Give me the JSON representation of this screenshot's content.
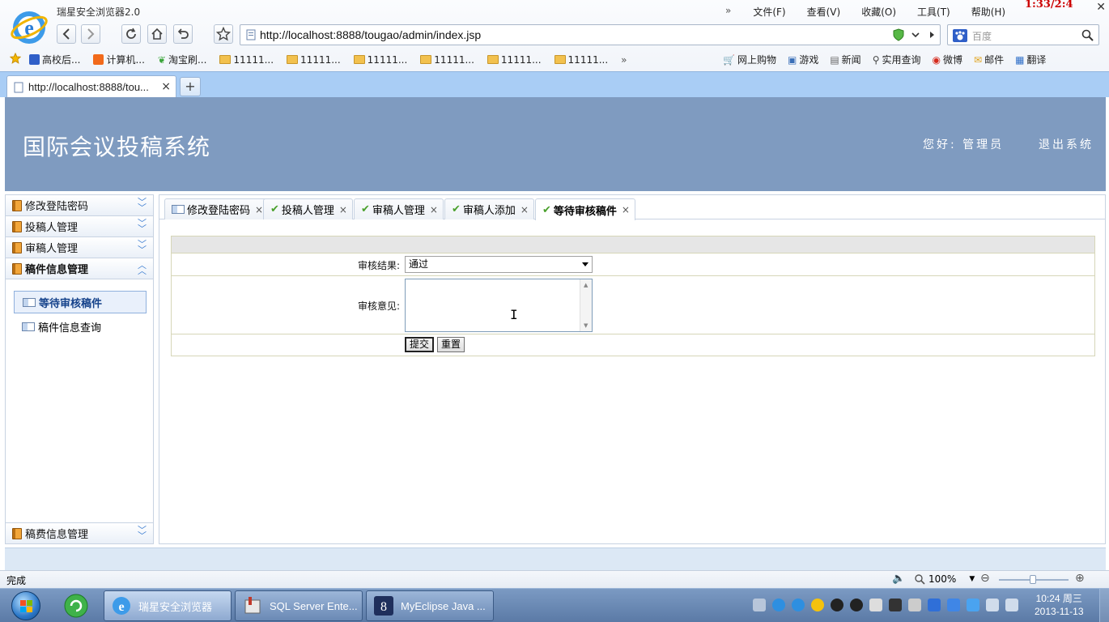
{
  "browser": {
    "app_title": "瑞星安全浏览器2.0",
    "timer": "1:33/2:4",
    "menu": [
      "文件(F)",
      "查看(V)",
      "收藏(O)",
      "工具(T)",
      "帮助(H)"
    ],
    "menu_more": "»",
    "url": "http://localhost:8888/tougao/admin/index.jsp",
    "search_placeholder": "百度",
    "favorites_left": [
      "高校后...",
      "计算机...",
      "淘宝刷...",
      "11111...",
      "11111...",
      "11111...",
      "11111...",
      "11111...",
      "11111..."
    ],
    "favorites_more": "»",
    "favorites_right": [
      "网上购物",
      "游戏",
      "新闻",
      "实用查询",
      "微博",
      "邮件",
      "翻译"
    ],
    "tab_title": "http://localhost:8888/tou...",
    "tab_close": "×",
    "new_tab": "+",
    "status_text": "完成",
    "zoom": "100%"
  },
  "page": {
    "system_title": "国际会议投稿系统",
    "greeting": "您好: 管理员",
    "logout": "退出系统"
  },
  "sidebar": {
    "groups": [
      {
        "label": "修改登陆密码",
        "expanded": false
      },
      {
        "label": "投稿人管理",
        "expanded": false
      },
      {
        "label": "审稿人管理",
        "expanded": false
      },
      {
        "label": "稿件信息管理",
        "expanded": true
      }
    ],
    "sub_items": [
      {
        "label": "等待审核稿件",
        "active": true
      },
      {
        "label": "稿件信息查询",
        "active": false
      }
    ],
    "bottom_group": {
      "label": "稿费信息管理"
    }
  },
  "content_tabs": [
    {
      "label": "修改登陆密码",
      "icon": "card-icon"
    },
    {
      "label": "投稿人管理",
      "icon": "check-icon"
    },
    {
      "label": "审稿人管理",
      "icon": "check-icon"
    },
    {
      "label": "审稿人添加",
      "icon": "check-icon"
    },
    {
      "label": "等待审核稿件",
      "icon": "check-icon",
      "active": true
    }
  ],
  "tab_close": "×",
  "form": {
    "result_label": "审核结果:",
    "result_value": "通过",
    "opinion_label": "审核意见:",
    "opinion_value": "",
    "submit_label": "提交",
    "reset_label": "重置"
  },
  "taskbar": {
    "tasks": [
      "瑞星安全浏览器",
      "SQL Server Ente...",
      "MyEclipse Java ..."
    ],
    "time": "10:24 周三",
    "date": "2013-11-13"
  },
  "colors": {
    "banner": "#7f9bc0",
    "tabstrip": "#a9cdf5",
    "accent_check": "#4aa02c"
  }
}
